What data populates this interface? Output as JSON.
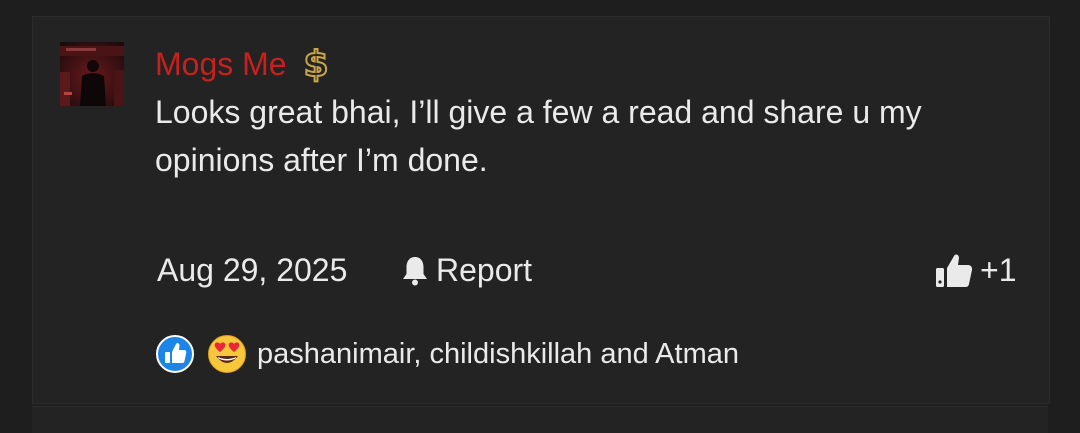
{
  "post": {
    "author": {
      "username": "Mogs Me",
      "name_color": "#c8201c",
      "badge_icon": "dollar-sign-icon",
      "avatar_icon": "avatar-image"
    },
    "message": "Looks great bhai, I’ll give a few a read and share u my opinions after I’m done.",
    "date": "Aug 29, 2025",
    "report_label": "Report",
    "report_icon": "bell-icon",
    "reaction_count": "+1",
    "reaction_button_icon": "thumbs-up-icon",
    "reactions_summary": {
      "icons": [
        "like-reaction-icon",
        "heart-eyes-reaction-icon"
      ],
      "names": "pashanimair, childishkillah and Atman"
    },
    "colors": {
      "background": "#1e1e1e",
      "card": "#232323",
      "text": "#eaeaea",
      "like_blue": "#1c86e8",
      "badge_gold": "#c9a44a"
    }
  }
}
